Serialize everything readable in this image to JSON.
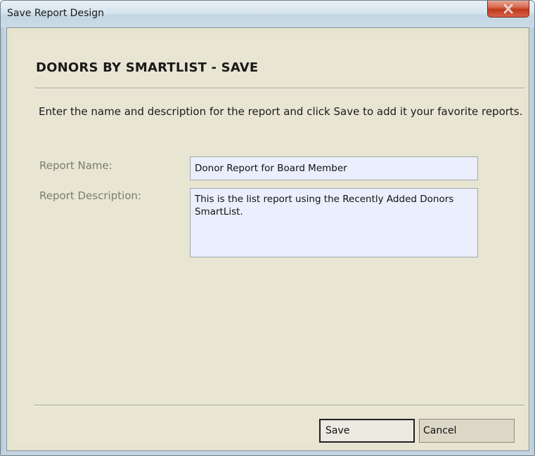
{
  "window": {
    "title": "Save Report Design",
    "close_icon": "close-icon"
  },
  "dialog": {
    "heading": "DONORS BY SMARTLIST - SAVE",
    "instructions": "Enter the name and description for the report and click Save to add it your favorite reports.",
    "report_name": {
      "label": "Report Name:",
      "value": "Donor Report for Board Member"
    },
    "report_description": {
      "label": "Report Description:",
      "value": "This is the list report using the Recently Added Donors SmartList."
    },
    "buttons": {
      "save": "Save",
      "cancel": "Cancel"
    }
  },
  "colors": {
    "dialog_background": "#e8e6d3",
    "field_background": "#ebeffd",
    "close_button": "#c0391c"
  }
}
